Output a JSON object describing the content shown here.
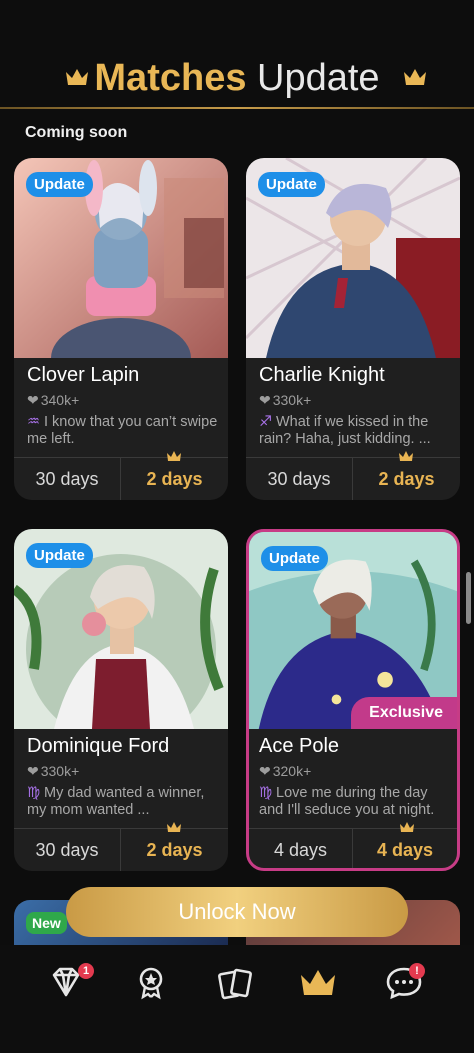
{
  "header": {
    "title_bold": "Matches",
    "title_rest": "Update"
  },
  "section": {
    "label": "Coming soon"
  },
  "cards": [
    {
      "badge": "Update",
      "name": "Clover Lapin",
      "likes": "340k+",
      "sign": "♒",
      "bio": "I know that you can’t swipe me left.",
      "left_days": "30 days",
      "right_days": "2 days"
    },
    {
      "badge": "Update",
      "name": "Charlie Knight",
      "likes": "330k+",
      "sign": "♐",
      "bio": "What if we kissed in the rain? Haha, just kidding. ...",
      "left_days": "30 days",
      "right_days": "2 days"
    },
    {
      "badge": "Update",
      "name": "Dominique Ford",
      "likes": "330k+",
      "sign": "♍",
      "bio": "My dad wanted a winner, my mom wanted ...",
      "left_days": "30 days",
      "right_days": "2 days"
    },
    {
      "badge": "Update",
      "exclusive": "Exclusive",
      "name": "Ace Pole",
      "likes": "320k+",
      "sign": "♍",
      "bio": "Love me during the day and I'll seduce you at night.",
      "left_days": "4 days",
      "right_days": "4 days"
    }
  ],
  "peek": {
    "badge": "New"
  },
  "unlock_button": {
    "label": "Unlock Now"
  },
  "nav": {
    "items": [
      "diamond-icon",
      "badge-icon",
      "cards-icon",
      "crown-icon",
      "chat-icon"
    ],
    "diamond_badge": "1",
    "chat_badge": "!"
  },
  "colors": {
    "gold": "#e9b756",
    "update_badge": "#1e8fe8",
    "exclusive": "#c23a8a",
    "new_badge": "#2fa84a",
    "background": "#0d0d0d"
  }
}
